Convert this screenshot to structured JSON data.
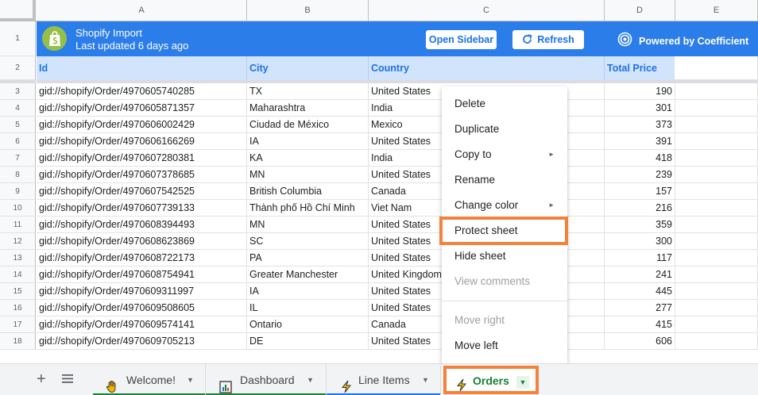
{
  "columns": [
    "A",
    "B",
    "C",
    "D",
    "E"
  ],
  "banner": {
    "title": "Shopify Import",
    "subtitle": "Last updated 6 days ago",
    "open_sidebar": "Open Sidebar",
    "refresh": "Refresh",
    "powered_by": "Powered by Coefficient",
    "color": "#2b7de9"
  },
  "headers": [
    "Id",
    "City",
    "Country",
    "Total Price"
  ],
  "rows": [
    {
      "num": "3",
      "id": "gid://shopify/Order/4970605740285",
      "city": "TX",
      "country": "United States",
      "total": "190"
    },
    {
      "num": "4",
      "id": "gid://shopify/Order/4970605871357",
      "city": "Maharashtra",
      "country": "India",
      "total": "301"
    },
    {
      "num": "5",
      "id": "gid://shopify/Order/4970606002429",
      "city": "Ciudad de México",
      "country": "Mexico",
      "total": "373"
    },
    {
      "num": "6",
      "id": "gid://shopify/Order/4970606166269",
      "city": "IA",
      "country": "United States",
      "total": "391"
    },
    {
      "num": "7",
      "id": "gid://shopify/Order/4970607280381",
      "city": "KA",
      "country": "India",
      "total": "418"
    },
    {
      "num": "8",
      "id": "gid://shopify/Order/4970607378685",
      "city": "MN",
      "country": "United States",
      "total": "239"
    },
    {
      "num": "9",
      "id": "gid://shopify/Order/4970607542525",
      "city": "British Columbia",
      "country": "Canada",
      "total": "157"
    },
    {
      "num": "10",
      "id": "gid://shopify/Order/4970607739133",
      "city": "Thành phố Hồ Chí Minh",
      "country": "Viet Nam",
      "total": "216"
    },
    {
      "num": "11",
      "id": "gid://shopify/Order/4970608394493",
      "city": "MN",
      "country": "United States",
      "total": "359"
    },
    {
      "num": "12",
      "id": "gid://shopify/Order/4970608623869",
      "city": "SC",
      "country": "United States",
      "total": "300"
    },
    {
      "num": "13",
      "id": "gid://shopify/Order/4970608722173",
      "city": "PA",
      "country": "United States",
      "total": "117"
    },
    {
      "num": "14",
      "id": "gid://shopify/Order/4970608754941",
      "city": "Greater Manchester",
      "country": "United Kingdom",
      "total": "241"
    },
    {
      "num": "15",
      "id": "gid://shopify/Order/4970609311997",
      "city": "IA",
      "country": "United States",
      "total": "445"
    },
    {
      "num": "16",
      "id": "gid://shopify/Order/4970609508605",
      "city": "IL",
      "country": "United States",
      "total": "277"
    },
    {
      "num": "17",
      "id": "gid://shopify/Order/4970609574141",
      "city": "Ontario",
      "country": "Canada",
      "total": "415"
    },
    {
      "num": "18",
      "id": "gid://shopify/Order/4970609705213",
      "city": "DE",
      "country": "United States",
      "total": "606"
    }
  ],
  "menu": {
    "delete": "Delete",
    "duplicate": "Duplicate",
    "copy_to": "Copy to",
    "rename": "Rename",
    "change_color": "Change color",
    "protect_sheet": "Protect sheet",
    "hide_sheet": "Hide sheet",
    "view_comments": "View comments",
    "move_right": "Move right",
    "move_left": "Move left"
  },
  "tabs": [
    {
      "label": "Welcome!",
      "icon": "hand-icon",
      "color": "#188038"
    },
    {
      "label": "Dashboard",
      "icon": "chart-icon",
      "color": "#188038"
    },
    {
      "label": "Line Items",
      "icon": "lightning-icon",
      "color": "#1a73e8"
    },
    {
      "label": "Orders",
      "icon": "lightning-icon",
      "active": true
    }
  ],
  "highlight_color": "#f4823d"
}
